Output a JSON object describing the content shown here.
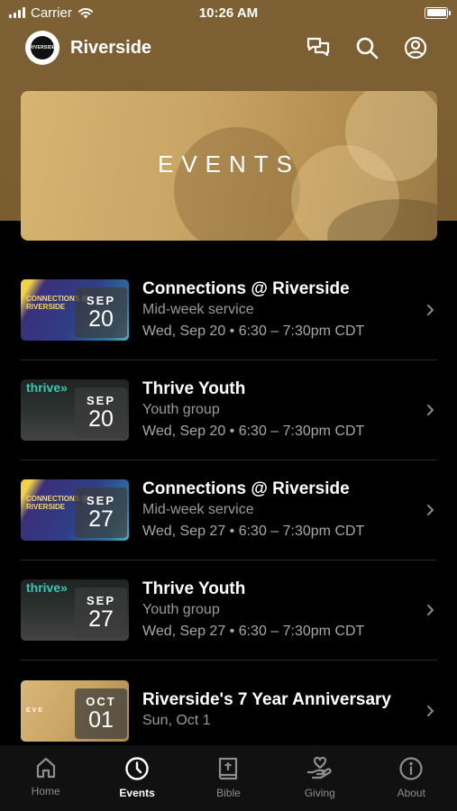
{
  "status_bar": {
    "carrier": "Carrier",
    "time": "10:26 AM"
  },
  "app_bar": {
    "brand_name": "Riverside",
    "logo_text": "RIVERSIDE"
  },
  "banner": {
    "title": "EVENTS"
  },
  "events": [
    {
      "thumb": "connections",
      "thumb_label": "CONNECTIONS @ RIVERSIDE",
      "month": "SEP",
      "day": "20",
      "title": "Connections @ Riverside",
      "subtitle": "Mid-week service",
      "when": "Wed, Sep 20 • 6:30 – 7:30pm CDT"
    },
    {
      "thumb": "thrive",
      "thumb_label": "thrive»",
      "month": "SEP",
      "day": "20",
      "title": "Thrive Youth",
      "subtitle": "Youth group",
      "when": "Wed, Sep 20 • 6:30 – 7:30pm CDT"
    },
    {
      "thumb": "connections",
      "thumb_label": "CONNECTIONS @ RIVERSIDE",
      "month": "SEP",
      "day": "27",
      "title": "Connections @ Riverside",
      "subtitle": "Mid-week service",
      "when": "Wed, Sep 27 • 6:30 – 7:30pm CDT"
    },
    {
      "thumb": "thrive",
      "thumb_label": "thrive»",
      "month": "SEP",
      "day": "27",
      "title": "Thrive Youth",
      "subtitle": "Youth group",
      "when": "Wed, Sep 27 • 6:30 – 7:30pm CDT"
    },
    {
      "thumb": "anniv",
      "thumb_label": "EVE",
      "month": "OCT",
      "day": "01",
      "title": "Riverside's 7 Year Anniversary",
      "subtitle": "Sun, Oct 1",
      "when": ""
    }
  ],
  "tabs": [
    {
      "label": "Home",
      "icon": "home-icon"
    },
    {
      "label": "Events",
      "icon": "clock-icon"
    },
    {
      "label": "Bible",
      "icon": "bible-icon"
    },
    {
      "label": "Giving",
      "icon": "giving-icon"
    },
    {
      "label": "About",
      "icon": "info-icon"
    }
  ],
  "active_tab": "Events",
  "colors": {
    "header_gold": "#7d6134",
    "tab_active": "#ffffff",
    "tab_inactive": "#8d8d8d"
  }
}
